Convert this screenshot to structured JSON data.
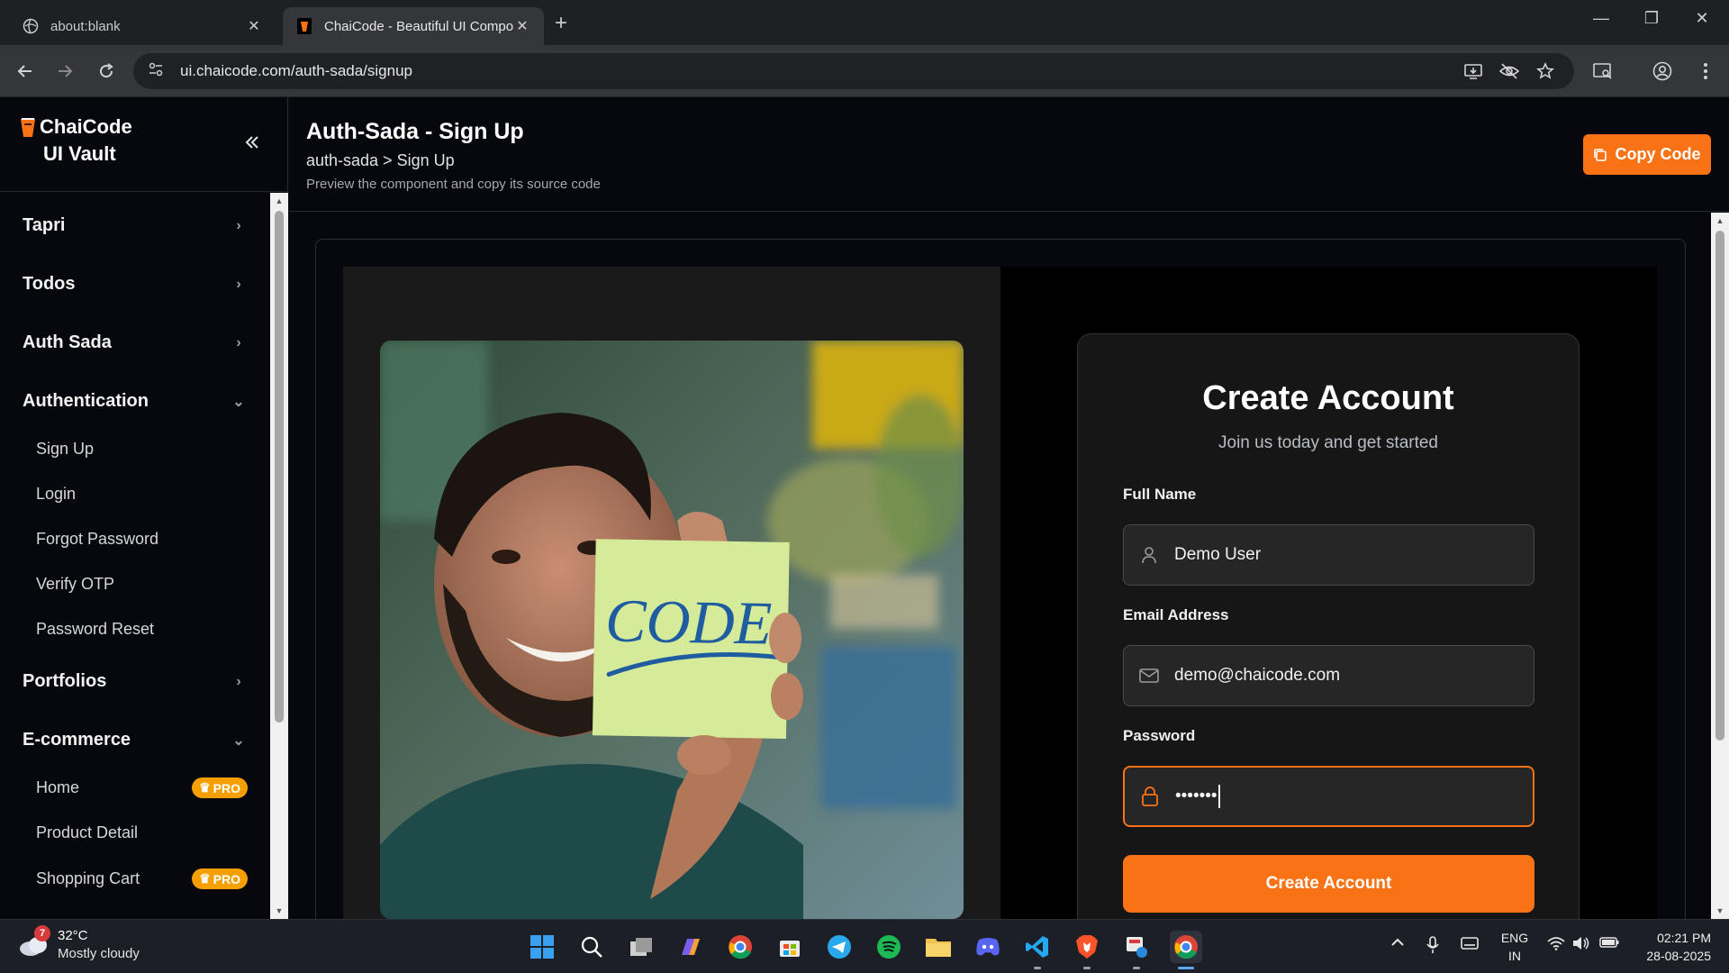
{
  "browser": {
    "tabs": [
      {
        "title": "about:blank",
        "active": false
      },
      {
        "title": "ChaiCode - Beautiful UI Compo",
        "active": true
      }
    ],
    "url": "ui.chaicode.com/auth-sada/signup"
  },
  "sidebar": {
    "brand_line1": "ChaiCode",
    "brand_line2": "UI Vault",
    "groups": [
      {
        "label": "Tapri",
        "expanded": false
      },
      {
        "label": "Todos",
        "expanded": false
      },
      {
        "label": "Auth Sada",
        "expanded": false
      },
      {
        "label": "Authentication",
        "expanded": true,
        "items": [
          "Sign Up",
          "Login",
          "Forgot Password",
          "Verify OTP",
          "Password Reset"
        ]
      },
      {
        "label": "Portfolios",
        "expanded": false
      },
      {
        "label": "E-commerce",
        "expanded": true,
        "items": [
          {
            "label": "Home",
            "badge": "PRO"
          },
          {
            "label": "Product Detail",
            "badge": ""
          },
          {
            "label": "Shopping Cart",
            "badge": "PRO"
          }
        ]
      }
    ]
  },
  "header": {
    "title": "Auth-Sada - Sign Up",
    "breadcrumb": "auth-sada > Sign Up",
    "description": "Preview the component and copy its source code",
    "copy_label": "Copy Code"
  },
  "preview": {
    "note_text": "CODE",
    "card_title": "Create Account",
    "card_subtitle": "Join us today and get started",
    "fields": [
      {
        "label": "Full Name",
        "value": "Demo User",
        "icon": "user-icon"
      },
      {
        "label": "Email Address",
        "value": "demo@chaicode.com",
        "icon": "mail-icon"
      },
      {
        "label": "Password",
        "value": "•••••••",
        "icon": "lock-icon",
        "focused": true
      }
    ],
    "submit_label": "Create Account"
  },
  "taskbar": {
    "weather_temp": "32°C",
    "weather_cond": "Mostly cloudy",
    "weather_badge": "7",
    "lang_top": "ENG",
    "lang_bottom": "IN",
    "time": "02:21 PM",
    "date": "28-08-2025"
  },
  "colors": {
    "accent": "#f97316",
    "pro_badge": "#f5a000"
  }
}
